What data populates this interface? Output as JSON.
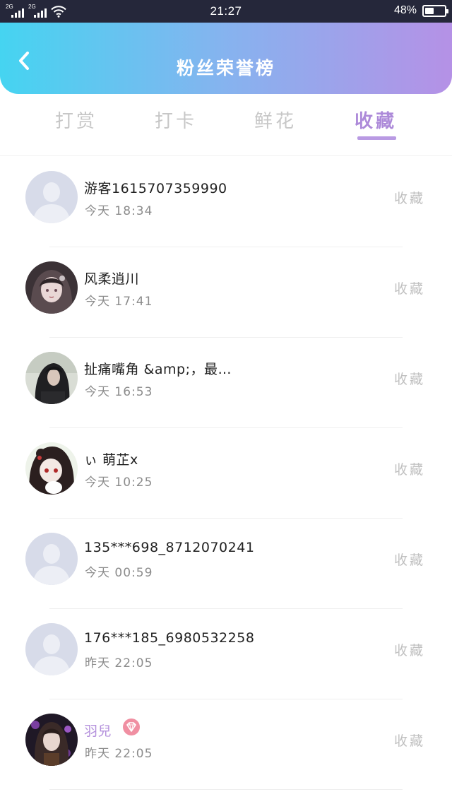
{
  "status_bar": {
    "network_1": "2G",
    "network_2": "2G",
    "time": "21:27",
    "battery_percent": "48%",
    "battery_level": 0.48
  },
  "header": {
    "title": "粉丝荣誉榜",
    "back_icon": "chevron-left-icon"
  },
  "tabs": [
    {
      "label": "打赏",
      "active": false
    },
    {
      "label": "打卡",
      "active": false
    },
    {
      "label": "鲜花",
      "active": false
    },
    {
      "label": "收藏",
      "active": true
    }
  ],
  "list": {
    "items": [
      {
        "name": "游客1615707359990",
        "time": "今天 18:34",
        "action": "收藏",
        "avatar": "default-avatar"
      },
      {
        "name": "风柔逍川",
        "time": "今天 17:41",
        "action": "收藏",
        "avatar": "anime-girl-avatar"
      },
      {
        "name": "扯痛嘴角 &amp;，最…",
        "time": "今天 16:53",
        "action": "收藏",
        "avatar": "girl-photo-avatar"
      },
      {
        "name": "ぃ 萌芷ⅹ",
        "time": "今天 10:25",
        "action": "收藏",
        "avatar": "anime-hood-avatar"
      },
      {
        "name": "135***698_8712070241",
        "time": "今天 00:59",
        "action": "收藏",
        "avatar": "default-avatar"
      },
      {
        "name": "176***185_6980532258",
        "time": "昨天 22:05",
        "action": "收藏",
        "avatar": "default-avatar"
      },
      {
        "name": "羽兒",
        "time": "昨天 22:05",
        "action": "收藏",
        "avatar": "anime-dark-avatar",
        "vip": true
      }
    ]
  },
  "colors": {
    "header_gradient_start": "#45d4f1",
    "header_gradient_end": "#b591e6",
    "tab_active": "#ad8ad9",
    "tab_inactive": "#c7c7c7",
    "vip_badge": "#f08fa2"
  }
}
